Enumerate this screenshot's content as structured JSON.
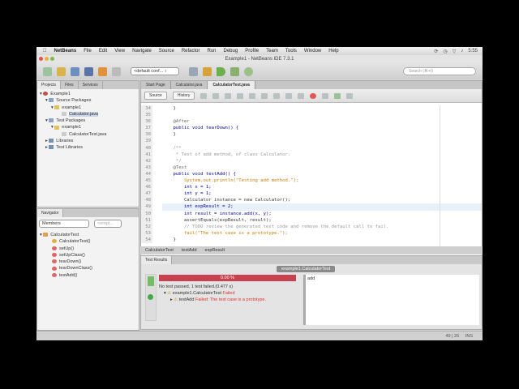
{
  "menubar": {
    "app": "NetBeans",
    "items": [
      "File",
      "Edit",
      "View",
      "Navigate",
      "Source",
      "Refactor",
      "Run",
      "Debug",
      "Profile",
      "Team",
      "Tools",
      "Window",
      "Help"
    ],
    "clock": "5:55"
  },
  "window": {
    "title": "Example1 - NetBeans IDE 7.3.1"
  },
  "toolbar": {
    "config": "<default conf... ↕",
    "search_placeholder": "Search (⌘+I)"
  },
  "projects": {
    "tabs": [
      "Projects",
      "Files",
      "Services"
    ],
    "tree": [
      "Example1",
      "Source Packages",
      "example1",
      "Calculator.java",
      "Test Packages",
      "example1",
      "CalculatorTest.java",
      "Libraries",
      "Test Libraries"
    ]
  },
  "navigator": {
    "title": "Navigator",
    "filter": "Members",
    "filter2": "<empt...",
    "tree": [
      "CalculatorTest",
      "CalculatorTest()",
      "setUp()",
      "setUpClass()",
      "tearDown()",
      "tearDownClass()",
      "testAdd()"
    ]
  },
  "editor": {
    "tabs": [
      "Start Page",
      "Calculator.java",
      "CalculatorTest.java"
    ],
    "source_btn": "Source",
    "history_btn": "History"
  },
  "code": [
    {
      "n": "34",
      "t": "    }"
    },
    {
      "n": "35",
      "t": ""
    },
    {
      "n": "36",
      "t": "    @After"
    },
    {
      "n": "37",
      "t": "    public void tearDown() {"
    },
    {
      "n": "38",
      "t": "    }"
    },
    {
      "n": "39",
      "t": ""
    },
    {
      "n": "40",
      "t": "    /**"
    },
    {
      "n": "41",
      "t": "     * Test of add method, of class Calculator."
    },
    {
      "n": "42",
      "t": "     */"
    },
    {
      "n": "43",
      "t": "    @Test"
    },
    {
      "n": "44",
      "t": "    public void testAdd() {"
    },
    {
      "n": "45",
      "t": "        System.out.println(\"Testing add method.\");"
    },
    {
      "n": "46",
      "t": "        int x = 1;"
    },
    {
      "n": "47",
      "t": "        int y = 1;"
    },
    {
      "n": "48",
      "t": "        Calculator instance = new Calculator();"
    },
    {
      "n": "49",
      "t": "        int expResult = 2;"
    },
    {
      "n": "50",
      "t": "        int result = instance.add(x, y);"
    },
    {
      "n": "51",
      "t": "        assertEquals(expResult, result);"
    },
    {
      "n": "52",
      "t": "        // TODO review the generated test code and remove the default call to fail."
    },
    {
      "n": "53",
      "t": "        fail(\"The test case is a prototype.\");"
    },
    {
      "n": "54",
      "t": "    }"
    }
  ],
  "breadcrumb": [
    "CalculatorTest",
    "testAdd",
    "expResult"
  ],
  "results": {
    "tab": "Test Results",
    "suite_tab": "example1.CalculatorTest",
    "progress_label": "0.00 %",
    "progress": 0.0,
    "summary": "No test passed, 1 test failed.(0.477 s)",
    "suite": "example1.CalculatorTest",
    "suite_status": "Failed",
    "test": "testAdd",
    "test_status": "Failed: The test case is a prototype.",
    "output": "add"
  },
  "status": {
    "position": "49 | 26",
    "mode": "INS"
  }
}
